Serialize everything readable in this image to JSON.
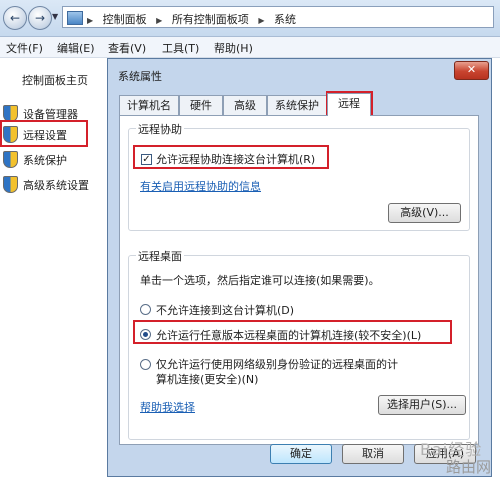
{
  "nav": {
    "back": "←",
    "forward": "→",
    "crumbs": [
      "控制面板",
      "所有控制面板项",
      "系统"
    ]
  },
  "menu": [
    "文件(F)",
    "编辑(E)",
    "查看(V)",
    "工具(T)",
    "帮助(H)"
  ],
  "sidebar": {
    "home": "控制面板主页",
    "items": [
      {
        "label": "设备管理器",
        "icon": "shield-icon"
      },
      {
        "label": "远程设置",
        "icon": "shield-icon"
      },
      {
        "label": "系统保护",
        "icon": "shield-icon"
      },
      {
        "label": "高级系统设置",
        "icon": "shield-icon"
      }
    ]
  },
  "dialog": {
    "title": "系统属性",
    "close": "✕",
    "tabs": [
      "计算机名",
      "硬件",
      "高级",
      "系统保护",
      "远程"
    ],
    "active_tab": "远程",
    "assist": {
      "title": "远程协助",
      "checkbox_label": "允许远程协助连接这台计算机(R)",
      "checkbox_checked": true,
      "link": "有关启用远程协助的信息",
      "advanced_button": "高级(V)..."
    },
    "desktop": {
      "title": "远程桌面",
      "instruction": "单击一个选项，然后指定谁可以连接(如果需要)。",
      "options": [
        {
          "label": "不允许连接到这台计算机(D)",
          "selected": false
        },
        {
          "label": "允许运行任意版本远程桌面的计算机连接(较不安全)(L)",
          "selected": true
        },
        {
          "label": "仅允许运行使用网络级别身份验证的远程桌面的计算机连接(更安全)(N)",
          "selected": false
        }
      ],
      "help_link": "帮助我选择",
      "select_users_button": "选择用户(S)..."
    },
    "ok": "确定",
    "cancel": "取消",
    "apply": "应用(A)"
  },
  "watermark": {
    "brand": "Bai经验",
    "site": "路由网"
  },
  "colors": {
    "highlight_red": "#d4202a",
    "link": "#1a5fb4"
  }
}
